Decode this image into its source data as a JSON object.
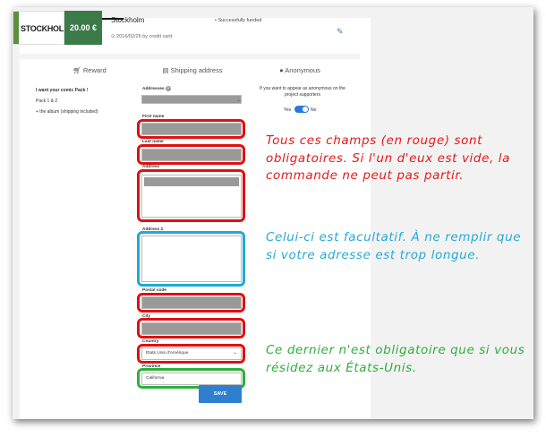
{
  "header": {
    "thumb_text": "STOCKHOLM",
    "price": "20.00 €",
    "title": "Stockholm",
    "status": "• Successfully funded",
    "date": "2016/02/26 by credit card"
  },
  "columns": {
    "reward": "Reward",
    "shipping": "Shipping address",
    "anonymous": "Anonymous"
  },
  "reward": {
    "line1": "I want your comic Pack !",
    "line2": "Pack 1 & 2",
    "line3": "+ the album (shipping included)"
  },
  "form": {
    "addresses_label": "Addresses",
    "first_name_label": "First name",
    "last_name_label": "Last name",
    "address_label": "Address",
    "address2_label": "Address 2",
    "postal_label": "Postal code",
    "city_label": "City",
    "country_label": "Country",
    "country_value": "Etats Unis d'Amérique",
    "province_label": "Province",
    "province_value": "California",
    "save_label": "SAVE"
  },
  "anonymous": {
    "text": "If you want to appear as anonymous on the project supporters",
    "yes": "Yes",
    "no": "No",
    "enabled": true
  },
  "notes": {
    "red": "Tous ces champs (en rouge) sont obligatoires. Si l'un d'eux est vide, la commande ne peut pas partir.",
    "blue": "Celui-ci est facultatif. À ne remplir que si votre adresse est trop longue.",
    "green": "Ce dernier n'est obligatoire que si vous résidez aux États-Unis."
  },
  "colors": {
    "required": "#e01010",
    "optional": "#20a8d8",
    "conditional": "#2fae3e",
    "accent": "#2f7fd1"
  }
}
